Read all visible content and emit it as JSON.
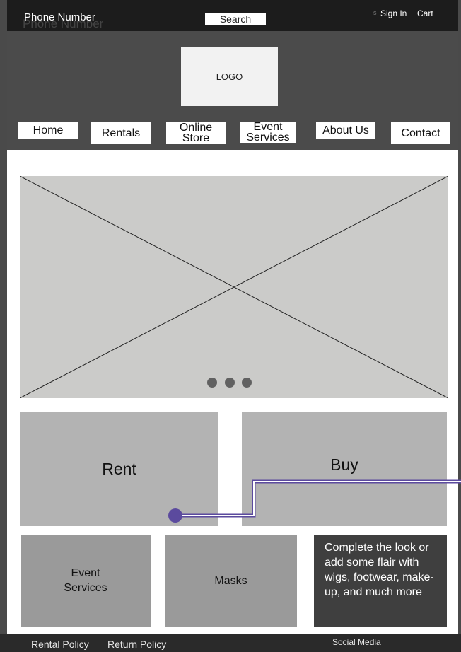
{
  "topbar": {
    "phone": "Phone Number",
    "phone_ghost": "Phone Number",
    "search": "Search",
    "sign_in": "Sign In",
    "cart": "Cart",
    "tiny_mark": "s"
  },
  "header": {
    "logo": "LOGO",
    "nav": [
      "Home",
      "Rentals",
      "Online\nStore",
      "Event\nServices",
      "About Us",
      "Contact"
    ]
  },
  "hero": {
    "slides_total": 3
  },
  "tiles": {
    "rent": "Rent",
    "buy": "Buy",
    "event_services": "Event\nServices",
    "masks": "Masks",
    "promo": "Complete the look or add some flair with wigs, footwear, make-up, and much more"
  },
  "footer": {
    "rental_policy": "Rental Policy",
    "return_policy": "Return Policy",
    "social_media": "Social Media"
  },
  "colors": {
    "connector": "#5b4a9e"
  }
}
